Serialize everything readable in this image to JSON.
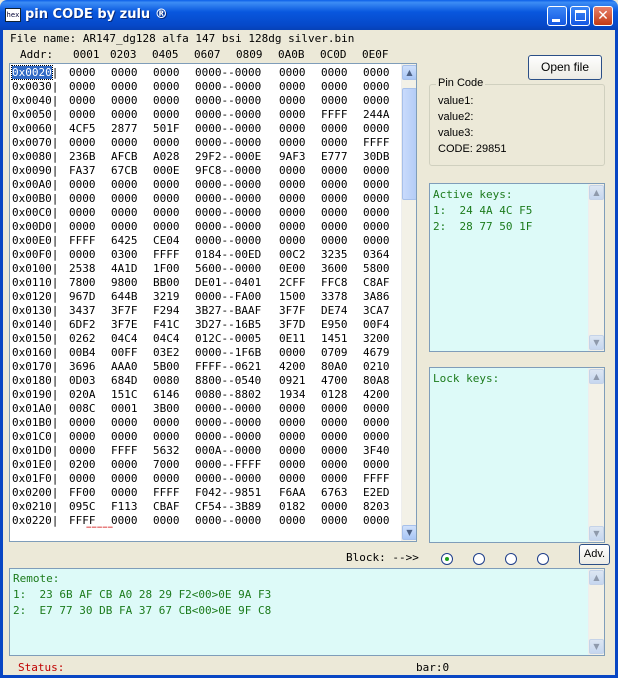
{
  "window": {
    "title": "pin CODE by zulu ®",
    "icon_text": "hex",
    "icon_name": "app-hex-icon"
  },
  "file_line": "File name: AR147_dg128 alfa 147 bsi 128dg silver.bin",
  "header": [
    "Addr:",
    "0001",
    "0203",
    "0405",
    "0607",
    "0809",
    "0A0B",
    "0C0D",
    "0E0F"
  ],
  "hex_rows": [
    [
      "0x0020|",
      "0000",
      "0000",
      "0000",
      "0000--0000",
      "0000",
      "0000",
      "0000"
    ],
    [
      "0x0030|",
      "0000",
      "0000",
      "0000",
      "0000--0000",
      "0000",
      "0000",
      "0000"
    ],
    [
      "0x0040|",
      "0000",
      "0000",
      "0000",
      "0000--0000",
      "0000",
      "0000",
      "0000"
    ],
    [
      "0x0050|",
      "0000",
      "0000",
      "0000",
      "0000--0000",
      "0000",
      "FFFF",
      "244A"
    ],
    [
      "0x0060|",
      "4CF5",
      "2877",
      "501F",
      "0000--0000",
      "0000",
      "0000",
      "0000"
    ],
    [
      "0x0070|",
      "0000",
      "0000",
      "0000",
      "0000--0000",
      "0000",
      "0000",
      "FFFF"
    ],
    [
      "0x0080|",
      "236B",
      "AFCB",
      "A028",
      "29F2--000E",
      "9AF3",
      "E777",
      "30DB"
    ],
    [
      "0x0090|",
      "FA37",
      "67CB",
      "000E",
      "9FC8--0000",
      "0000",
      "0000",
      "0000"
    ],
    [
      "0x00A0|",
      "0000",
      "0000",
      "0000",
      "0000--0000",
      "0000",
      "0000",
      "0000"
    ],
    [
      "0x00B0|",
      "0000",
      "0000",
      "0000",
      "0000--0000",
      "0000",
      "0000",
      "0000"
    ],
    [
      "0x00C0|",
      "0000",
      "0000",
      "0000",
      "0000--0000",
      "0000",
      "0000",
      "0000"
    ],
    [
      "0x00D0|",
      "0000",
      "0000",
      "0000",
      "0000--0000",
      "0000",
      "0000",
      "0000"
    ],
    [
      "0x00E0|",
      "FFFF",
      "6425",
      "CE04",
      "0000--0000",
      "0000",
      "0000",
      "0000"
    ],
    [
      "0x00F0|",
      "0000",
      "0300",
      "FFFF",
      "0184--00ED",
      "00C2",
      "3235",
      "0364"
    ],
    [
      "0x0100|",
      "2538",
      "4A1D",
      "1F00",
      "5600--0000",
      "0E00",
      "3600",
      "5800"
    ],
    [
      "0x0110|",
      "7800",
      "9800",
      "BB00",
      "DE01--0401",
      "2CFF",
      "FFC8",
      "C8AF"
    ],
    [
      "0x0120|",
      "967D",
      "644B",
      "3219",
      "0000--FA00",
      "1500",
      "3378",
      "3A86"
    ],
    [
      "0x0130|",
      "3437",
      "3F7F",
      "F294",
      "3B27--BAAF",
      "3F7F",
      "DE74",
      "3CA7"
    ],
    [
      "0x0140|",
      "6DF2",
      "3F7E",
      "F41C",
      "3D27--16B5",
      "3F7D",
      "E950",
      "00F4"
    ],
    [
      "0x0150|",
      "0262",
      "04C4",
      "04C4",
      "012C--0005",
      "0E11",
      "1451",
      "3200"
    ],
    [
      "0x0160|",
      "00B4",
      "00FF",
      "03E2",
      "0000--1F6B",
      "0000",
      "0709",
      "4679"
    ],
    [
      "0x0170|",
      "3696",
      "AAA0",
      "5B00",
      "FFFF--0621",
      "4200",
      "80A0",
      "0210"
    ],
    [
      "0x0180|",
      "0D03",
      "684D",
      "0080",
      "8800--0540",
      "0921",
      "4700",
      "80A8"
    ],
    [
      "0x0190|",
      "020A",
      "151C",
      "6146",
      "0080--8802",
      "1934",
      "0128",
      "4200"
    ],
    [
      "0x01A0|",
      "008C",
      "0001",
      "3B00",
      "0000--0000",
      "0000",
      "0000",
      "0000"
    ],
    [
      "0x01B0|",
      "0000",
      "0000",
      "0000",
      "0000--0000",
      "0000",
      "0000",
      "0000"
    ],
    [
      "0x01C0|",
      "0000",
      "0000",
      "0000",
      "0000--0000",
      "0000",
      "0000",
      "0000"
    ],
    [
      "0x01D0|",
      "0000",
      "FFFF",
      "5632",
      "000A--0000",
      "0000",
      "0000",
      "3F40"
    ],
    [
      "0x01E0|",
      "0200",
      "0000",
      "7000",
      "0000--FFFF",
      "0000",
      "0000",
      "0000"
    ],
    [
      "0x01F0|",
      "0000",
      "0000",
      "0000",
      "0000--0000",
      "0000",
      "0000",
      "FFFF"
    ],
    [
      "0x0200|",
      "FF00",
      "0000",
      "FFFF",
      "F042--9851",
      "F6AA",
      "6763",
      "E2ED"
    ],
    [
      "0x0210|",
      "095C",
      "F113",
      "CBAF",
      "CF54--3B89",
      "0182",
      "0000",
      "8203"
    ],
    [
      "0x0220|",
      "FFFF",
      "0000",
      "0000",
      "0000--0000",
      "0000",
      "0000",
      "0000"
    ]
  ],
  "cursor_mark": "=====",
  "open_file_label": "Open file",
  "pin_code": {
    "legend": "Pin Code",
    "value1": "value1:",
    "value2": "value2:",
    "value3": "value3:",
    "code": "CODE: 29851"
  },
  "active_keys": {
    "title": "Active keys:",
    "lines": [
      "1:  24 4A 4C F5",
      "2:  28 77 50 1F"
    ]
  },
  "lock_keys": {
    "title": "Lock keys:"
  },
  "block": {
    "label": "Block: -->>",
    "selected_index": 0,
    "count": 4
  },
  "adv_label": "Adv.",
  "remote": {
    "title": "Remote:",
    "lines": [
      "1:  23 6B AF CB A0 28 29 F2<00>0E 9A F3",
      "2:  E7 77 30 DB FA 37 67 CB<00>0E 9F C8"
    ]
  },
  "status_label": "Status:",
  "bar_label": "bar:0",
  "colors": {
    "title_bar": "#0857de",
    "text_green": "#1c7b1c",
    "box_bg": "#ddfaf8",
    "status_red": "#c00000"
  }
}
